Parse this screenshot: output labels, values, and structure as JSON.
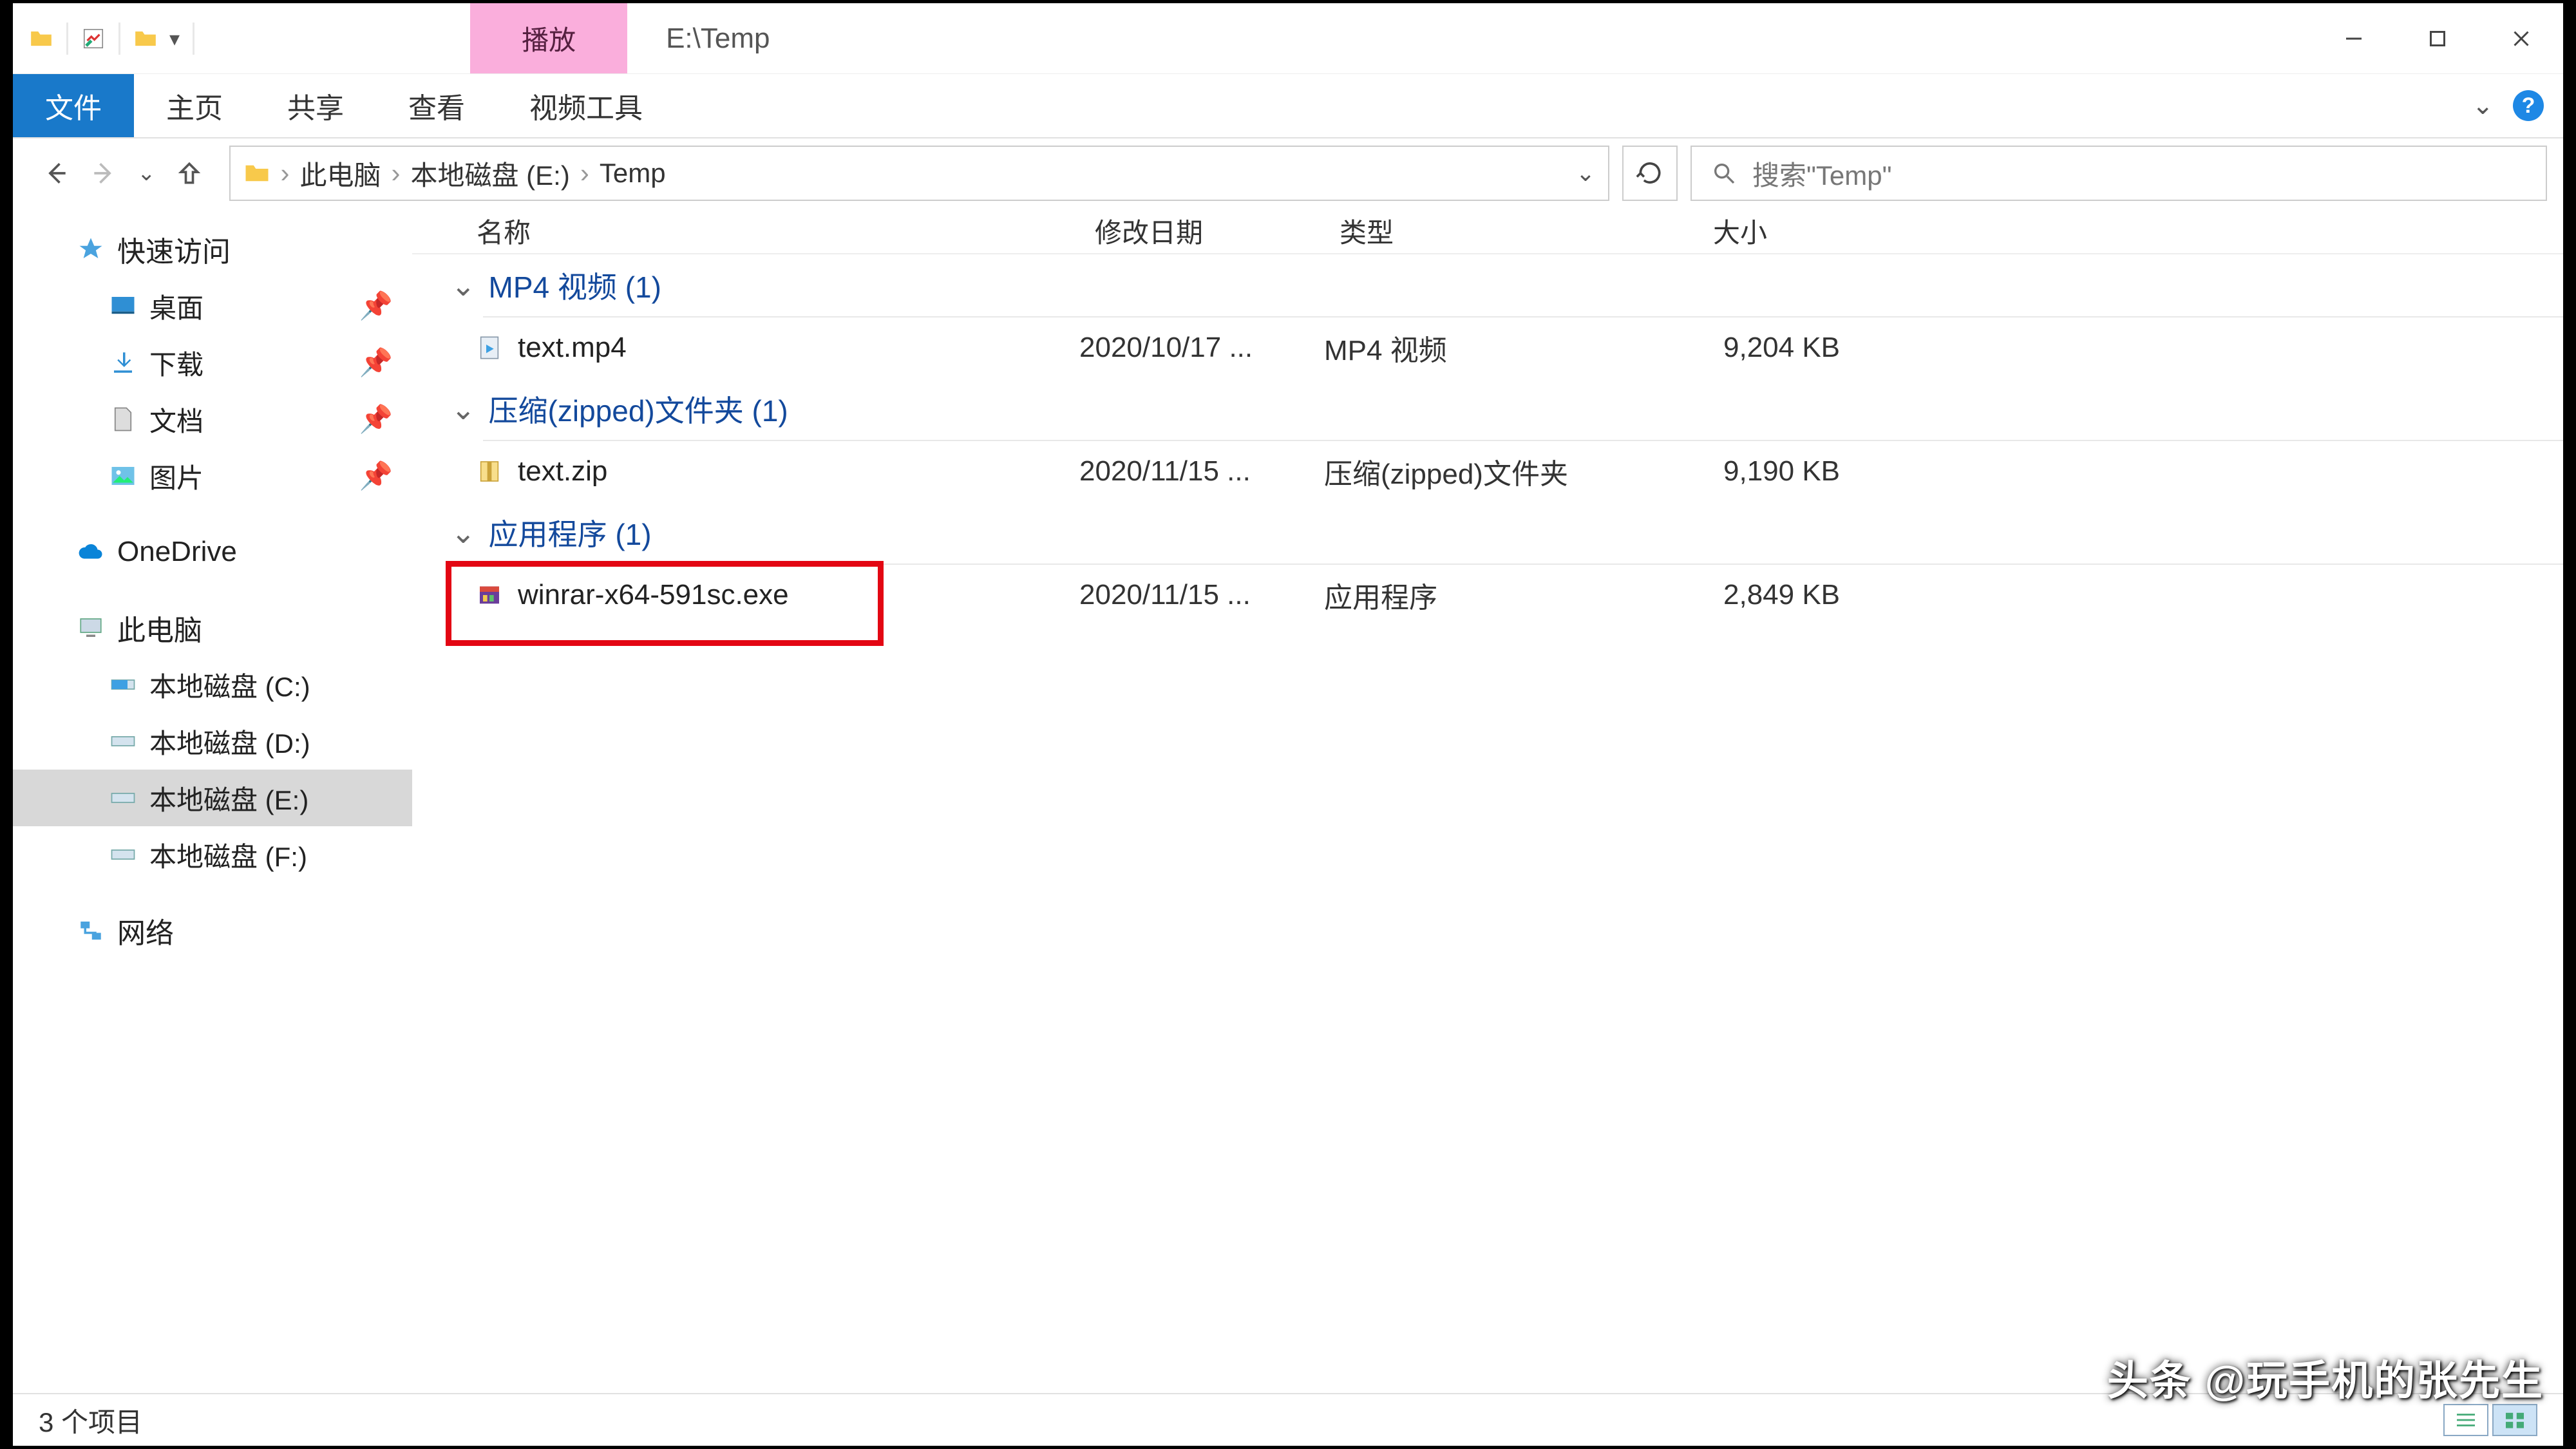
{
  "titlebar": {
    "context_tab": "播放",
    "title": "E:\\Temp"
  },
  "ribbon": {
    "file": "文件",
    "home": "主页",
    "share": "共享",
    "view": "查看",
    "video_tools": "视频工具"
  },
  "breadcrumb": {
    "pc": "此电脑",
    "drive": "本地磁盘 (E:)",
    "folder": "Temp"
  },
  "search": {
    "placeholder": "搜索\"Temp\""
  },
  "sidebar": {
    "quick_access": "快速访问",
    "desktop": "桌面",
    "downloads": "下载",
    "documents": "文档",
    "pictures": "图片",
    "onedrive": "OneDrive",
    "this_pc": "此电脑",
    "drive_c": "本地磁盘 (C:)",
    "drive_d": "本地磁盘 (D:)",
    "drive_e": "本地磁盘 (E:)",
    "drive_f": "本地磁盘 (F:)",
    "network": "网络"
  },
  "columns": {
    "name": "名称",
    "date": "修改日期",
    "type": "类型",
    "size": "大小"
  },
  "groups": [
    {
      "title": "MP4 视频 (1)",
      "files": [
        {
          "name": "text.mp4",
          "date": "2020/10/17 ...",
          "type": "MP4 视频",
          "size": "9,204 KB",
          "icon": "video"
        }
      ]
    },
    {
      "title": "压缩(zipped)文件夹 (1)",
      "files": [
        {
          "name": "text.zip",
          "date": "2020/11/15 ...",
          "type": "压缩(zipped)文件夹",
          "size": "9,190 KB",
          "icon": "zip"
        }
      ]
    },
    {
      "title": "应用程序 (1)",
      "files": [
        {
          "name": "winrar-x64-591sc.exe",
          "date": "2020/11/15 ...",
          "type": "应用程序",
          "size": "2,849 KB",
          "icon": "exe",
          "highlighted": true
        }
      ]
    }
  ],
  "statusbar": {
    "items": "3 个项目"
  },
  "watermark": "头条 @玩手机的张先生"
}
